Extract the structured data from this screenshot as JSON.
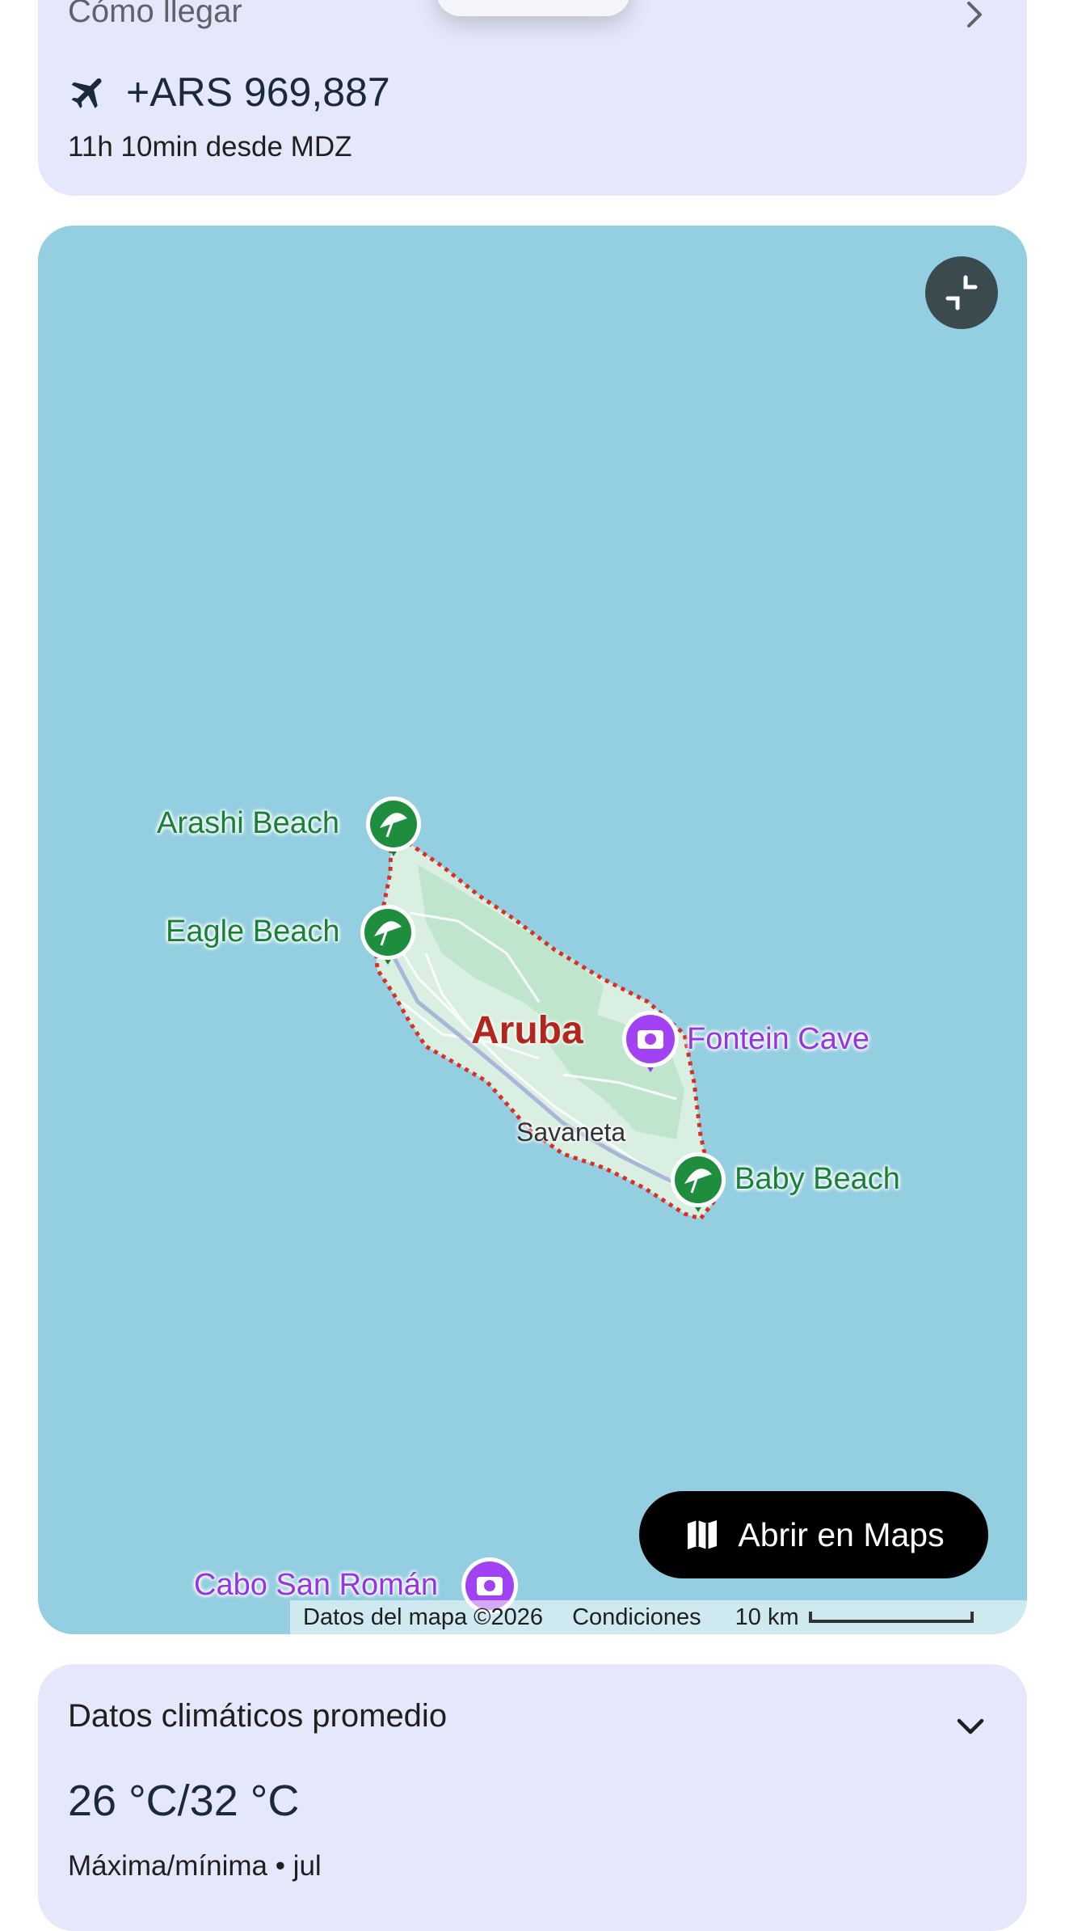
{
  "directions": {
    "title": "Cómo llegar",
    "flight_icon": "airplane-icon",
    "price": "+ARS 969,887",
    "duration_origin": "11h 10min desde MDZ"
  },
  "map": {
    "collapse_icon": "collapse-icon",
    "water_color": "#94cfe1",
    "land_color": "#d9efe1",
    "labels": {
      "island": "Aruba",
      "town": "Savaneta",
      "arashi": "Arashi Beach",
      "eagle": "Eagle Beach",
      "fontein": "Fontein Cave",
      "baby": "Baby Beach",
      "cabo": "Cabo San Román"
    },
    "open_button": {
      "label": "Abrir en Maps",
      "icon": "map-icon"
    },
    "attribution": {
      "data": "Datos del mapa ©2026",
      "terms": "Condiciones",
      "scale": "10 km"
    }
  },
  "weather": {
    "title": "Datos climáticos promedio",
    "temps": "26 °C/32 °C",
    "subtitle": "Máxima/mínima • jul"
  },
  "colors": {
    "card_bg": "#e5e8fb",
    "beach_green": "#188038",
    "poi_purple": "#9334e6",
    "border_red": "#d93025"
  }
}
